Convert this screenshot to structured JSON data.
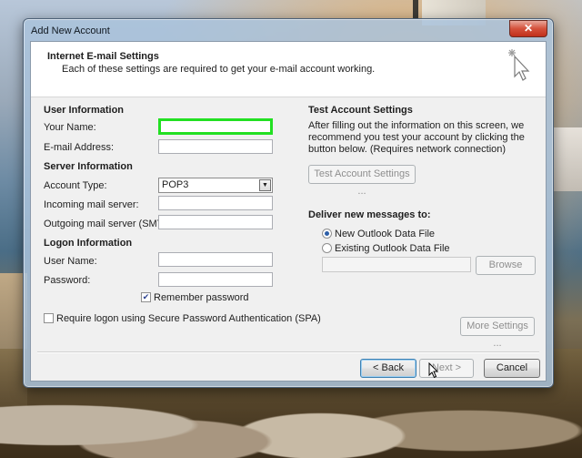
{
  "window": {
    "title": "Add New Account",
    "close_glyph": "✕"
  },
  "header": {
    "title": "Internet E-mail Settings",
    "subtitle": "Each of these settings are required to get your e-mail account working."
  },
  "user_info": {
    "section": "User Information",
    "name_label": "Your Name:",
    "name_value": "",
    "email_label": "E-mail Address:",
    "email_value": ""
  },
  "server_info": {
    "section": "Server Information",
    "account_type_label": "Account Type:",
    "account_type_value": "POP3",
    "incoming_label": "Incoming mail server:",
    "incoming_value": "",
    "outgoing_label": "Outgoing mail server (SMTP):",
    "outgoing_value": ""
  },
  "logon_info": {
    "section": "Logon Information",
    "username_label": "User Name:",
    "username_value": "",
    "password_label": "Password:",
    "password_value": "",
    "remember_label": "Remember password",
    "remember_checked": true,
    "spa_label": "Require logon using Secure Password Authentication (SPA)",
    "spa_checked": false
  },
  "test_settings": {
    "section": "Test Account Settings",
    "description": "After filling out the information on this screen, we recommend you test your account by clicking the button below. (Requires network connection)",
    "test_button": "Test Account Settings ..."
  },
  "deliver": {
    "section": "Deliver new messages to:",
    "option_new": "New Outlook Data File",
    "option_existing": "Existing Outlook Data File",
    "selected": "new",
    "browse_button": "Browse",
    "file_path": ""
  },
  "more_settings_button": "More Settings ...",
  "nav": {
    "back": "< Back",
    "next": "Next >",
    "cancel": "Cancel"
  },
  "colors": {
    "focus_highlight": "#22e022",
    "close_button": "#c1301b"
  }
}
